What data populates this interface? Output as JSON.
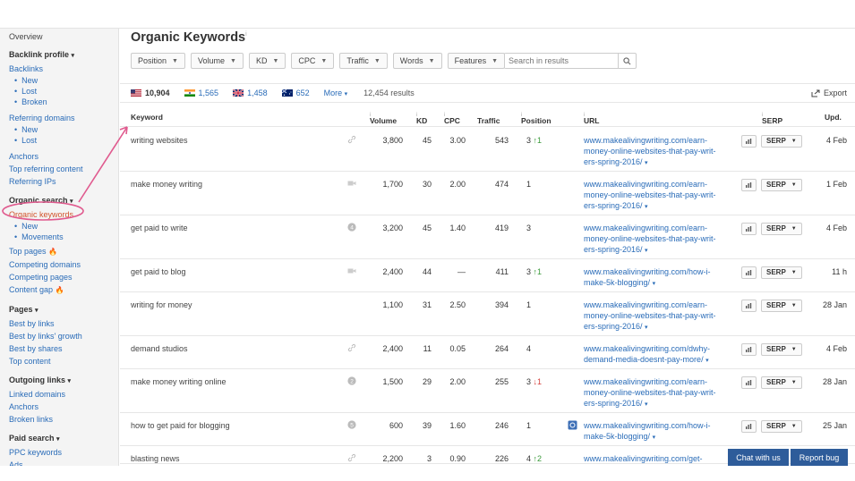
{
  "sidebar": {
    "overview": "Overview",
    "backlink_profile": "Backlink profile",
    "backlinks": "Backlinks",
    "backlinks_sub": [
      "New",
      "Lost",
      "Broken"
    ],
    "referring_domains": "Referring domains",
    "referring_domains_sub": [
      "New",
      "Lost"
    ],
    "anchors": "Anchors",
    "top_referring_content": "Top referring content",
    "referring_ips": "Referring IPs",
    "organic_search": "Organic search",
    "organic_keywords": "Organic keywords",
    "organic_sub": [
      "New",
      "Movements"
    ],
    "top_pages": "Top pages",
    "competing_domains": "Competing domains",
    "competing_pages": "Competing pages",
    "content_gap": "Content gap",
    "pages": "Pages",
    "best_by_links": "Best by links",
    "best_by_links_growth": "Best by links' growth",
    "best_by_shares": "Best by shares",
    "top_content": "Top content",
    "outgoing_links": "Outgoing links",
    "linked_domains": "Linked domains",
    "anchors2": "Anchors",
    "broken_links": "Broken links",
    "paid_search": "Paid search",
    "ppc_keywords": "PPC keywords",
    "ads": "Ads"
  },
  "main": {
    "title": "Organic Keywords",
    "title_info": "i",
    "filters": [
      "Position",
      "Volume",
      "KD",
      "CPC",
      "Traffic",
      "Words",
      "Features"
    ],
    "search_placeholder": "Search in results",
    "countries": [
      {
        "code": "US",
        "count": "10,904"
      },
      {
        "code": "IN",
        "count": "1,565"
      },
      {
        "code": "UK",
        "count": "1,458"
      },
      {
        "code": "AU",
        "count": "652"
      }
    ],
    "more": "More",
    "results": "12,454 results",
    "export": "Export"
  },
  "table": {
    "headers": {
      "keyword": "Keyword",
      "volume": "Volume",
      "kd": "KD",
      "cpc": "CPC",
      "traffic": "Traffic",
      "traffic_sort": "↓",
      "position": "Position",
      "url": "URL",
      "serp": "SERP",
      "upd": "Upd."
    },
    "serp_label": "SERP",
    "rows": [
      {
        "keyword": "writing websites",
        "icon": "link-icon",
        "volume": "3,800",
        "kd": "45",
        "cpc": "3.00",
        "traffic": "543",
        "position": "3",
        "change": "↑1",
        "url_lines": [
          "www.makealivingwriting.com/earn-",
          "money-online-websites-that-pay-writ-",
          "ers-spring-2016/"
        ],
        "upd": "4 Feb"
      },
      {
        "keyword": "make money writing",
        "icon": "video-icon",
        "volume": "1,700",
        "kd": "30",
        "cpc": "2.00",
        "traffic": "474",
        "position": "1",
        "change": "",
        "url_lines": [
          "www.makealivingwriting.com/earn-",
          "money-online-websites-that-pay-writ-",
          "ers-spring-2016/"
        ],
        "upd": "1 Feb"
      },
      {
        "keyword": "get paid to write",
        "icon": "number-4-icon",
        "volume": "3,200",
        "kd": "45",
        "cpc": "1.40",
        "traffic": "419",
        "position": "3",
        "change": "",
        "url_lines": [
          "www.makealivingwriting.com/earn-",
          "money-online-websites-that-pay-writ-",
          "ers-spring-2016/"
        ],
        "upd": "4 Feb"
      },
      {
        "keyword": "get paid to blog",
        "icon": "video-icon",
        "volume": "2,400",
        "kd": "44",
        "cpc": "—",
        "traffic": "411",
        "position": "3",
        "change": "↑1",
        "url_lines": [
          "www.makealivingwriting.com/how-i-",
          "make-5k-blogging/"
        ],
        "upd": "11 h"
      },
      {
        "keyword": "writing for money",
        "icon": "",
        "volume": "1,100",
        "kd": "31",
        "cpc": "2.50",
        "traffic": "394",
        "position": "1",
        "change": "",
        "url_lines": [
          "www.makealivingwriting.com/earn-",
          "money-online-websites-that-pay-writ-",
          "ers-spring-2016/"
        ],
        "upd": "28 Jan"
      },
      {
        "keyword": "demand studios",
        "icon": "link-icon",
        "volume": "2,400",
        "kd": "11",
        "cpc": "0.05",
        "traffic": "264",
        "position": "4",
        "change": "",
        "url_lines": [
          "www.makealivingwriting.com/dwhy-",
          "demand-media-doesnt-pay-more/"
        ],
        "upd": "4 Feb"
      },
      {
        "keyword": "make money writing online",
        "icon": "number-2-icon",
        "volume": "1,500",
        "kd": "29",
        "cpc": "2.00",
        "traffic": "255",
        "position": "3",
        "change": "↓1",
        "url_lines": [
          "www.makealivingwriting.com/earn-",
          "money-online-websites-that-pay-writ-",
          "ers-spring-2016/"
        ],
        "upd": "28 Jan"
      },
      {
        "keyword": "how to get paid for blogging",
        "icon": "number-5-icon",
        "volume": "600",
        "kd": "39",
        "cpc": "1.60",
        "traffic": "246",
        "position": "1",
        "change": "",
        "url_lines": [
          "www.makealivingwriting.com/how-i-",
          "make-5k-blogging/"
        ],
        "upd": "25 Jan"
      },
      {
        "keyword": "blasting news",
        "icon": "link-icon",
        "volume": "2,200",
        "kd": "3",
        "cpc": "0.90",
        "traffic": "226",
        "position": "4",
        "change": "↑2",
        "url_lines": [
          "www.makealivingwriting.com/get-"
        ],
        "upd": ""
      }
    ]
  },
  "footer": {
    "chat": "Chat with us",
    "report": "Report bug"
  },
  "colors": {
    "link": "#2a6cb8",
    "active": "#d2542c",
    "annotation": "#e05a8e",
    "button_blue": "#2e5c9a",
    "up": "#3a9a3a",
    "down": "#d43f3a"
  }
}
